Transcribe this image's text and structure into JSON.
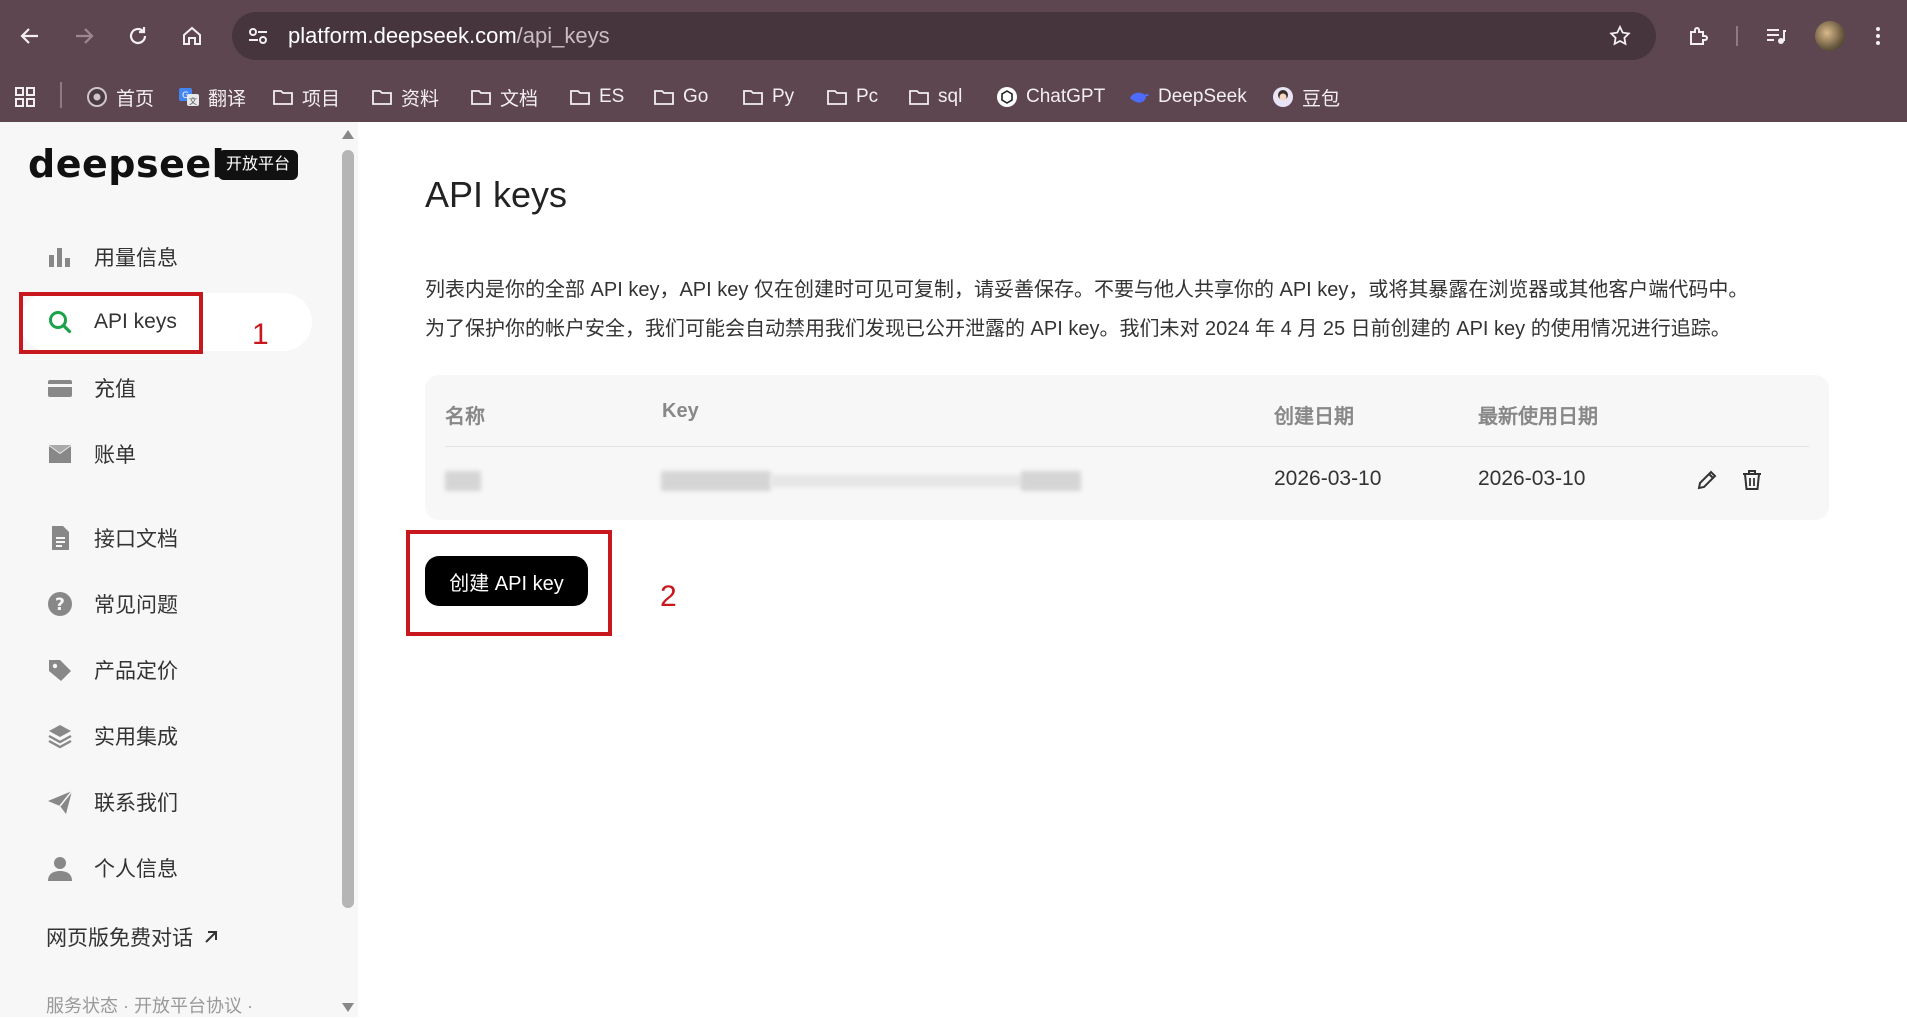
{
  "browser": {
    "url_host": "platform.deepseek.com",
    "url_path": "/api_keys",
    "bookmarks": [
      {
        "label": "首页",
        "icon": "chrome-icon"
      },
      {
        "label": "翻译",
        "icon": "translate-icon"
      },
      {
        "label": "项目",
        "icon": "folder-icon"
      },
      {
        "label": "资料",
        "icon": "folder-icon"
      },
      {
        "label": "文档",
        "icon": "folder-icon"
      },
      {
        "label": "ES",
        "icon": "folder-icon"
      },
      {
        "label": "Go",
        "icon": "folder-icon"
      },
      {
        "label": "Py",
        "icon": "folder-icon"
      },
      {
        "label": "Pc",
        "icon": "folder-icon"
      },
      {
        "label": "sql",
        "icon": "folder-icon"
      },
      {
        "label": "ChatGPT",
        "icon": "chatgpt-icon"
      },
      {
        "label": "DeepSeek",
        "icon": "deepseek-icon"
      },
      {
        "label": "豆包",
        "icon": "doubao-icon"
      }
    ]
  },
  "sidebar": {
    "logo": "deepseek",
    "badge": "开放平台",
    "items": [
      {
        "label": "用量信息",
        "icon": "bar-chart-icon"
      },
      {
        "label": "API keys",
        "icon": "search-icon"
      },
      {
        "label": "充值",
        "icon": "card-icon"
      },
      {
        "label": "账单",
        "icon": "inbox-icon"
      },
      {
        "label": "接口文档",
        "icon": "document-icon"
      },
      {
        "label": "常见问题",
        "icon": "question-icon"
      },
      {
        "label": "产品定价",
        "icon": "tag-icon"
      },
      {
        "label": "实用集成",
        "icon": "layers-icon"
      },
      {
        "label": "联系我们",
        "icon": "send-icon"
      },
      {
        "label": "个人信息",
        "icon": "user-icon"
      }
    ],
    "web_link": "网页版免费对话",
    "footer": "服务状态 · 开放平台协议 ·"
  },
  "main": {
    "title": "API keys",
    "desc_line1": "列表内是你的全部 API key，API key 仅在创建时可见可复制，请妥善保存。不要与他人共享你的 API key，或将其暴露在浏览器或其他客户端代码中。",
    "desc_line2": "为了保护你的帐户安全，我们可能会自动禁用我们发现已公开泄露的 API key。我们未对 2024 年 4 月 25 日前创建的 API key 的使用情况进行追踪。",
    "table": {
      "headers": [
        "名称",
        "Key",
        "创建日期",
        "最新使用日期"
      ],
      "rows": [
        {
          "created": "2026-03-10",
          "last_used": "2026-03-10"
        }
      ]
    },
    "create_button": "创建 API key"
  },
  "annotations": {
    "marker_1": "1",
    "marker_2": "2",
    "color": "#c8171d"
  },
  "colors": {
    "chrome": "#5d4650",
    "active_icon": "#1aa34a",
    "button": "#000000"
  }
}
